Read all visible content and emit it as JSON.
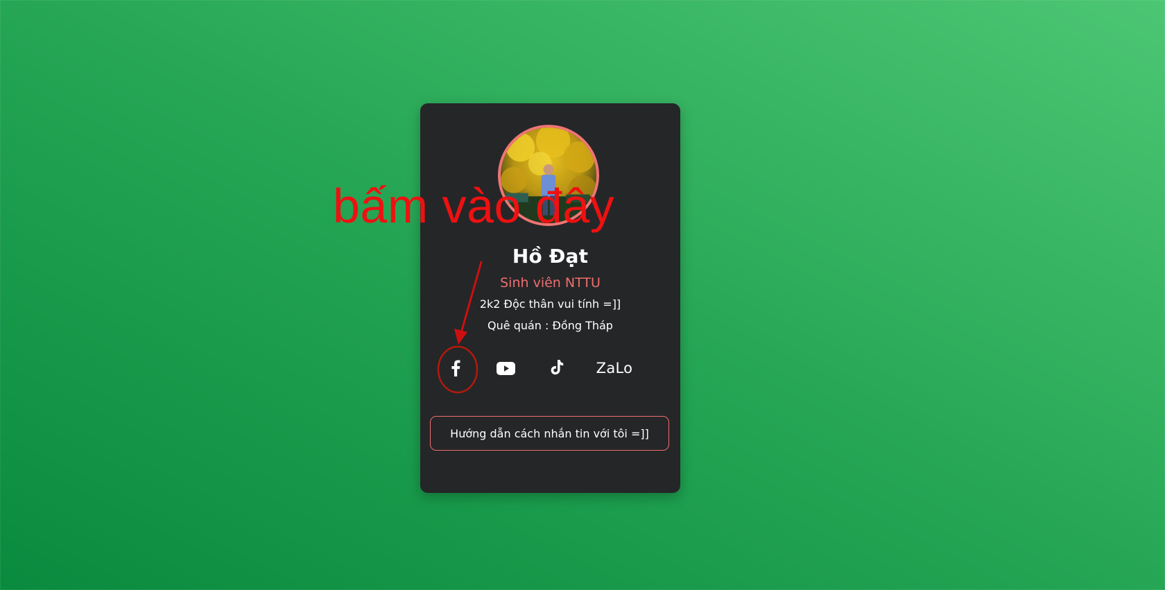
{
  "profile": {
    "name": "Hồ Đạt",
    "role": "Sinh viên NTTU",
    "bio": "2k2 Độc thân vui tính =]]",
    "hometown": "Quê quán : Đồng Tháp"
  },
  "social": {
    "items": [
      {
        "icon": "facebook-icon"
      },
      {
        "icon": "youtube-icon"
      },
      {
        "icon": "tiktok-icon"
      },
      {
        "label": "ZaLo"
      }
    ]
  },
  "guide_button": {
    "label": "Hướng dẫn cách nhắn tin với tôi =]]"
  },
  "annotation": {
    "text": "bấm vào đây"
  },
  "colors": {
    "accent": "#ef6f6f",
    "card_bg": "#252628",
    "annotation": "#ee1111"
  }
}
